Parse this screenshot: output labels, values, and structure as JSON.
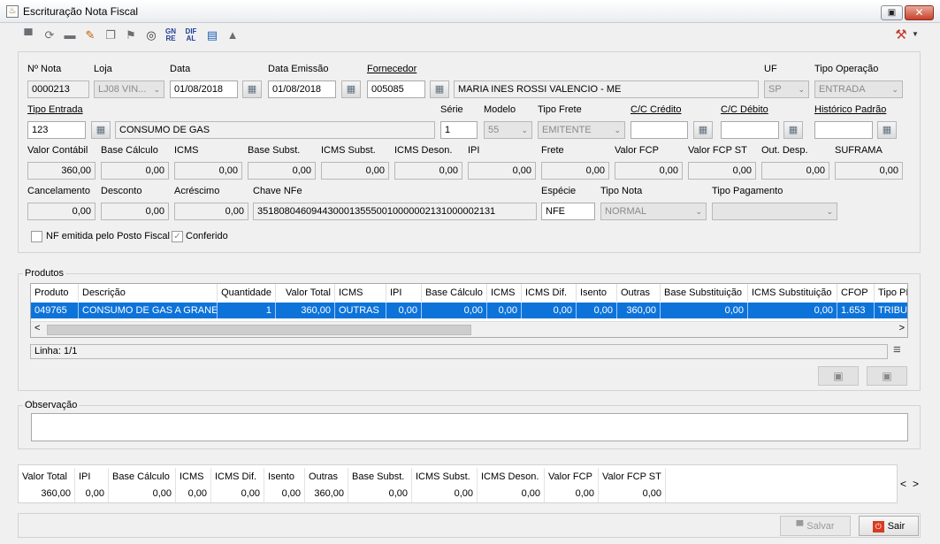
{
  "window": {
    "title": "Escrituração Nota Fiscal",
    "controls": {
      "restore": "▣",
      "close": "✕"
    }
  },
  "toolbar": {
    "icons": [
      {
        "name": "save-icon",
        "glyph": "▀"
      },
      {
        "name": "refresh-icon",
        "glyph": "⟳"
      },
      {
        "name": "comment-icon",
        "glyph": "▬"
      },
      {
        "name": "edit-note-icon",
        "glyph": "✎"
      },
      {
        "name": "copy-icon",
        "glyph": "❐"
      },
      {
        "name": "tag-icon",
        "glyph": "⚑"
      },
      {
        "name": "binoculars-icon",
        "glyph": "◎"
      }
    ],
    "gnre_label": "GN RE",
    "difal_label": "DIF AL",
    "report_glyph": "▤",
    "warning_glyph": "▲",
    "tools_glyph": "⚒"
  },
  "header": {
    "nota_label": "Nº Nota",
    "nota_value": "0000213",
    "loja_label": "Loja",
    "loja_value": "LJ08 VIN...",
    "data_label": "Data",
    "data_value": "01/08/2018",
    "data_emissao_label": "Data Emissão",
    "data_emissao_value": "01/08/2018",
    "fornecedor_label": "Fornecedor",
    "fornecedor_code": "005085",
    "fornecedor_name": "MARIA INES ROSSI VALENCIO - ME",
    "uf_label": "UF",
    "uf_value": "SP",
    "tipo_operacao_label": "Tipo Operação",
    "tipo_operacao_value": "ENTRADA",
    "tipo_entrada_label": "Tipo Entrada",
    "tipo_entrada_code": "123",
    "tipo_entrada_desc": "CONSUMO DE GAS",
    "serie_label": "Série",
    "serie_value": "1",
    "modelo_label": "Modelo",
    "modelo_value": "55",
    "tipo_frete_label": "Tipo Frete",
    "tipo_frete_value": "EMITENTE",
    "cc_credito_label": "C/C Crédito",
    "cc_credito_value": "",
    "cc_debito_label": "C/C Débito",
    "cc_debito_value": "",
    "historico_label": "Histórico Padrão",
    "historico_value": "",
    "values": [
      {
        "label": "Valor Contábil",
        "value": "360,00"
      },
      {
        "label": "Base Cálculo",
        "value": "0,00"
      },
      {
        "label": "ICMS",
        "value": "0,00"
      },
      {
        "label": "Base Subst.",
        "value": "0,00"
      },
      {
        "label": "ICMS Subst.",
        "value": "0,00"
      },
      {
        "label": "ICMS Deson.",
        "value": "0,00"
      },
      {
        "label": "IPI",
        "value": "0,00"
      },
      {
        "label": "Frete",
        "value": "0,00"
      },
      {
        "label": "Valor FCP",
        "value": "0,00"
      },
      {
        "label": "Valor FCP ST",
        "value": "0,00"
      },
      {
        "label": "Out. Desp.",
        "value": "0,00"
      },
      {
        "label": "SUFRAMA",
        "value": "0,00"
      }
    ],
    "cancelamento_label": "Cancelamento",
    "cancelamento_value": "0,00",
    "desconto_label": "Desconto",
    "desconto_value": "0,00",
    "acrescimo_label": "Acréscimo",
    "acrescimo_value": "0,00",
    "chave_label": "Chave NFe",
    "chave_value": "35180804609443000135550010000002131000002131",
    "especie_label": "Espécie",
    "especie_value": "NFE",
    "tipo_nota_label": "Tipo Nota",
    "tipo_nota_value": "NORMAL",
    "tipo_pagamento_label": "Tipo Pagamento",
    "tipo_pagamento_value": "",
    "nf_posto_label": "NF emitida pelo Posto Fiscal",
    "conferido_label": "Conferido",
    "conferido_glyph": "✓",
    "lookup_glyph": "▦",
    "calendar_glyph": "▦",
    "dropdown_glyph": "⌄"
  },
  "produtos": {
    "title": "Produtos",
    "columns": [
      "Produto",
      "Descrição",
      "Quantidade",
      "Valor Total",
      "ICMS",
      "IPI",
      "Base Cálculo",
      "ICMS",
      "ICMS Dif.",
      "Isento",
      "Outras",
      "Base Substituição",
      "ICMS Substituição",
      "CFOP",
      "Tipo PI"
    ],
    "row": [
      "049765",
      "CONSUMO DE GAS A GRANEL",
      "1",
      "360,00",
      "OUTRAS",
      "0,00",
      "0,00",
      "0,00",
      "0,00",
      "0,00",
      "360,00",
      "0,00",
      "0,00",
      "1.653",
      "TRIBUT"
    ],
    "linha": "Linha: 1/1",
    "scroll_left": "<",
    "scroll_right": ">",
    "menu_glyph": "≡",
    "btn1_glyph": "▣",
    "btn2_glyph": "▣"
  },
  "observacao": {
    "title": "Observação",
    "value": ""
  },
  "totals": {
    "columns": [
      "Valor Total",
      "IPI",
      "Base Cálculo",
      "ICMS",
      "ICMS Dif.",
      "Isento",
      "Outras",
      "Base Subst.",
      "ICMS Subst.",
      "ICMS Deson.",
      "Valor FCP",
      "Valor FCP ST"
    ],
    "values": [
      "360,00",
      "0,00",
      "0,00",
      "0,00",
      "0,00",
      "0,00",
      "360,00",
      "0,00",
      "0,00",
      "0,00",
      "0,00",
      "0,00"
    ],
    "nav_left": "<",
    "nav_right": ">"
  },
  "footer": {
    "salvar_label": "Salvar",
    "salvar_glyph": "▀",
    "sair_label": "Sair",
    "sair_glyph": "⏻"
  },
  "colors": {
    "selection": "#0d73d9",
    "close_red": "#c7402b"
  }
}
